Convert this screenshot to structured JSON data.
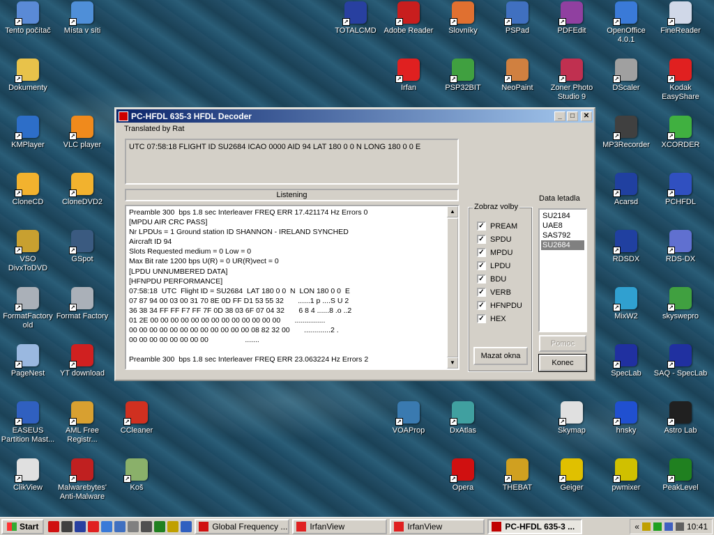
{
  "desktop_icons": [
    {
      "label": "Tento počítač",
      "icon": "computer-icon",
      "color": "#5a8ad6"
    },
    {
      "label": "Místa v síti",
      "icon": "network-places-icon",
      "color": "#4f8fd8"
    },
    {
      "label": "Dokumenty",
      "icon": "folder-icon",
      "color": "#e8c24a"
    },
    {
      "label": "KMPlayer",
      "icon": "kmplayer-icon",
      "color": "#2d6ec8"
    },
    {
      "label": "VLC player",
      "icon": "vlc-cone-icon",
      "color": "#f08a1c"
    },
    {
      "label": "CloneCD",
      "icon": "clonecd-sheep-icon",
      "color": "#f2b22e"
    },
    {
      "label": "CloneDVD2",
      "icon": "clonedvd-sheep-icon",
      "color": "#f2b22e"
    },
    {
      "label": "VSO DivxToDVD",
      "icon": "film-reel-icon",
      "color": "#c8a030"
    },
    {
      "label": "GSpot",
      "icon": "gspot-face-icon",
      "color": "#3a5a80"
    },
    {
      "label": "FormatFactory old",
      "icon": "format-factory-icon",
      "color": "#aab0b8"
    },
    {
      "label": "Format Factory",
      "icon": "format-factory-icon",
      "color": "#aab0b8"
    },
    {
      "label": "PageNest",
      "icon": "pagenest-icon",
      "color": "#9ab8e0"
    },
    {
      "label": "YT download",
      "icon": "download-icon",
      "color": "#d02020"
    },
    {
      "label": "EASEUS Partition Mast...",
      "icon": "easeus-icon",
      "color": "#3060c0"
    },
    {
      "label": "AML Free Registr...",
      "icon": "magnifier-icon",
      "color": "#d8a030"
    },
    {
      "label": "CCleaner",
      "icon": "ccleaner-icon",
      "color": "#d03020"
    },
    {
      "label": "ClikView",
      "icon": "clikview-icon",
      "color": "#e0e0e0"
    },
    {
      "label": "Malwarebytes' Anti-Malware",
      "icon": "malwarebytes-icon",
      "color": "#c02020"
    },
    {
      "label": "Koš",
      "icon": "recycle-bin-icon",
      "color": "#8ab06a"
    },
    {
      "label": "TOTALCMD",
      "icon": "floppy-icon",
      "color": "#2840a0"
    },
    {
      "label": "Adobe Reader",
      "icon": "adobe-reader-icon",
      "color": "#c81e1e"
    },
    {
      "label": "Slovníky",
      "icon": "dictionary-icon",
      "color": "#e07030"
    },
    {
      "label": "PSPad",
      "icon": "pspad-icon",
      "color": "#4070c0"
    },
    {
      "label": "PDFEdit",
      "icon": "pdfedit-icon",
      "color": "#9040a0"
    },
    {
      "label": "OpenOffice 4.0.1",
      "icon": "openoffice-icon",
      "color": "#3a7ad8"
    },
    {
      "label": "FineReader",
      "icon": "finereader-icon",
      "color": "#d0d8e8"
    },
    {
      "label": "Irfan",
      "icon": "irfan-cat-icon",
      "color": "#e02020"
    },
    {
      "label": "PSP32BIT",
      "icon": "paint-shop-icon",
      "color": "#40a040"
    },
    {
      "label": "NeoPaint",
      "icon": "neopaint-icon",
      "color": "#d08040"
    },
    {
      "label": "Zoner Photo Studio 9",
      "icon": "zoner-icon",
      "color": "#c03050"
    },
    {
      "label": "DScaler",
      "icon": "dscaler-icon",
      "color": "#a0a0a0"
    },
    {
      "label": "Kodak EasyShare",
      "icon": "kodak-icon",
      "color": "#e02020"
    },
    {
      "label": "MP3Recorder",
      "icon": "microphone-icon",
      "color": "#404040"
    },
    {
      "label": "XCORDER",
      "icon": "xcorder-icon",
      "color": "#40b040"
    },
    {
      "label": "Acarsd",
      "icon": "acarsd-icon",
      "color": "#2040a0"
    },
    {
      "label": "PCHFDL",
      "icon": "pchfdl-icon",
      "color": "#3050c0"
    },
    {
      "label": "RDSDX",
      "icon": "rds-icon",
      "color": "#2040a0"
    },
    {
      "label": "RDS-DX",
      "icon": "rds-dx-icon",
      "color": "#6070d0"
    },
    {
      "label": "MixW2",
      "icon": "butterfly-icon",
      "color": "#30a0d0"
    },
    {
      "label": "skyswepro",
      "icon": "sun-icon",
      "color": "#40a040"
    },
    {
      "label": "SpecLab",
      "icon": "satellite-dish-icon",
      "color": "#2030a0"
    },
    {
      "label": "SAQ - SpecLab",
      "icon": "satellite-dish-icon",
      "color": "#2030a0"
    },
    {
      "label": "VOAProp",
      "icon": "voaprop-icon",
      "color": "#3a7ab0"
    },
    {
      "label": "DxAtlas",
      "icon": "dxatlas-icon",
      "color": "#40a0a0"
    },
    {
      "label": "Skymap",
      "icon": "skymap-icon",
      "color": "#e0e0e0"
    },
    {
      "label": "hnsky",
      "icon": "hnsky-icon",
      "color": "#2050d0"
    },
    {
      "label": "Astro Lab",
      "icon": "moon-icon",
      "color": "#202020"
    },
    {
      "label": "Opera",
      "icon": "opera-icon",
      "color": "#d01010"
    },
    {
      "label": "THEBAT",
      "icon": "bat-icon",
      "color": "#d0a020"
    },
    {
      "label": "Geiger",
      "icon": "radiation-icon",
      "color": "#e0c000"
    },
    {
      "label": "pwmixer",
      "icon": "speaker-icon",
      "color": "#d0c000"
    },
    {
      "label": "PeakLevel",
      "icon": "level-meter-icon",
      "color": "#208020"
    }
  ],
  "window": {
    "title": "PC-HFDL 635-3 HFDL Decoder",
    "translated_by": "Translated by Rat",
    "utc_line": "UTC 07:58:18  FLIGHT ID SU2684 ICAO 0000 AID 94 LAT 180 0 0  N  LONG 180 0 0  E",
    "status": "Listening",
    "log_lines": [
      "Preamble 300  bps 1.8 sec Interleaver FREQ ERR 17.421174 Hz Errors 0",
      "[MPDU AIR CRC PASS]",
      "Nr LPDUs = 1 Ground station ID SHANNON - IRELAND SYNCHED",
      "Aircraft ID 94",
      "Slots Requested medium = 0 Low = 0",
      "Max Bit rate 1200 bps U(R) = 0 UR(R)vect = 0",
      "[LPDU UNNUMBERED DATA]",
      "[HFNPDU PERFORMANCE]",
      "07:58:18  UTC  Flight ID = SU2684  LAT 180 0 0  N  LON 180 0 0  E",
      "07 87 94 00 03 00 31 70 8E 0D FF D1 53 55 32       ......1 p ....S U 2",
      "36 38 34 FF FF F7 FF 7F 0D 38 03 6F 07 04 32       6 8 4 ......8 .o ..2",
      "01 2E 00 00 00 00 00 00 00 00 00 00 00 00 00       ...............",
      "00 00 00 00 00 00 00 00 00 00 00 00 08 82 32 00       .............2 .",
      "00 00 00 00 00 00 00 00                  .......",
      "",
      "Preamble 300  bps 1.8 sec Interleaver FREQ ERR 23.063224 Hz Errors 2"
    ],
    "options_group_title": "Zobraz volby",
    "options": [
      {
        "label": "PREAM",
        "checked": "✓"
      },
      {
        "label": "SPDU",
        "checked": "✓"
      },
      {
        "label": "MPDU",
        "checked": "✓"
      },
      {
        "label": "LPDU",
        "checked": "✓"
      },
      {
        "label": "BDU",
        "checked": "✓"
      },
      {
        "label": "VERB",
        "checked": "✓"
      },
      {
        "label": "HFNPDU",
        "checked": "✓"
      },
      {
        "label": "HEX",
        "checked": "✓"
      }
    ],
    "clear_button": "Mazat okna",
    "aircraft_label": "Data letadla",
    "aircraft_list": [
      "SU2184",
      "UAE8",
      "SAS792",
      "SU2684"
    ],
    "selected_aircraft": "SU2684",
    "help_button": "Pomoc",
    "end_button": "Konec",
    "title_buttons": {
      "minimize": "_",
      "maximize": "□",
      "close": "✕"
    }
  },
  "taskbar": {
    "start_label": "Start",
    "items": [
      {
        "label": "Global Frequency ...",
        "icon": "opera-icon",
        "color": "#d01010"
      },
      {
        "label": "IrfanView",
        "icon": "irfan-cat-icon",
        "color": "#e02020"
      },
      {
        "label": "IrfanView",
        "icon": "irfan-cat-icon",
        "color": "#e02020"
      },
      {
        "label": "PC-HFDL 635-3 ...",
        "icon": "pchfdl-icon",
        "color": "#c00000"
      }
    ],
    "tray_arrow": "«",
    "clock": "10:41"
  }
}
